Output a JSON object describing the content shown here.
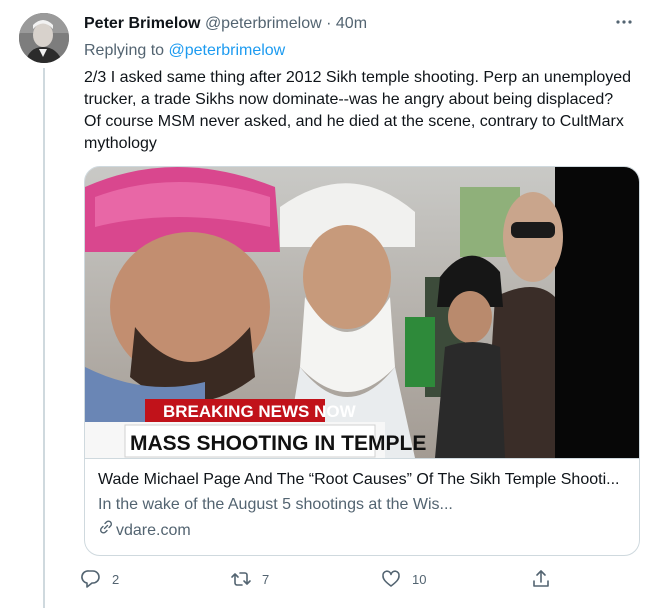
{
  "tweet": {
    "author_name": "Peter Brimelow",
    "author_handle": "@peterbrimelow",
    "separator": "·",
    "time": "40m",
    "replying_prefix": "Replying to",
    "replying_to": "@peterbrimelow",
    "text": "2/3 I asked same thing after 2012 Sikh temple shooting. Perp an unemployed trucker, a trade Sikhs now dominate--was he angry about being displaced? Of course MSM never asked, and he died at the scene, contrary to CultMarx mythology"
  },
  "card": {
    "image_caption_top": "BREAKING NEWS NOW",
    "image_caption_bottom": "MASS SHOOTING IN TEMPLE",
    "title": "Wade Michael Page And The “Root Causes” Of The Sikh Temple Shooti...",
    "description": "In the wake of the August 5 shootings at the Wis...",
    "domain": "vdare.com"
  },
  "actions": {
    "reply_count": "2",
    "retweet_count": "7",
    "like_count": "10"
  },
  "icons": {
    "more": "more-icon",
    "reply": "reply-icon",
    "retweet": "retweet-icon",
    "like": "heart-icon",
    "share": "share-icon",
    "link": "link-icon"
  },
  "colors": {
    "link": "#1d9bf0",
    "secondary_text": "#536471",
    "border": "#cfd9de"
  }
}
